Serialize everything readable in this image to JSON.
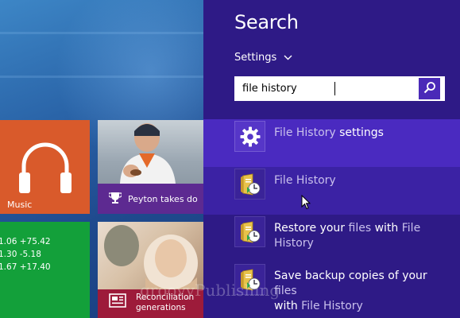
{
  "start_screen": {
    "tiles": {
      "music": {
        "label": "Music",
        "color": "#d95a2b",
        "icon": "headphones-icon"
      },
      "sports": {
        "caption": "Peyton takes do",
        "color": "#5d2a91",
        "icon": "trophy-icon"
      },
      "finance": {
        "rows": [
          "1.06  +75.42",
          "1.30  -5.18",
          "1.67  +17.40"
        ],
        "color": "#13a03a"
      },
      "news": {
        "caption_line1": "Reconciliation",
        "caption_line2": "generations",
        "color": "#9d1b3a",
        "icon": "newspaper-icon"
      }
    }
  },
  "search_charm": {
    "title": "Search",
    "scope": "Settings",
    "query": "file history",
    "search_button_icon": "magnifier-icon",
    "accent": "#4a2ac0",
    "results": [
      {
        "icon": "gear-icon",
        "highlight": "File History",
        "rest": " settings",
        "selected": true
      },
      {
        "icon": "file-history-folder-icon",
        "highlight": "File History",
        "rest": ""
      },
      {
        "icon": "file-history-folder-icon",
        "prefix": "Restore your ",
        "highlight": "files",
        "middle": " with ",
        "highlight2": "File History"
      },
      {
        "icon": "file-history-folder-icon",
        "prefix": "Save backup copies of your ",
        "highlight": "files",
        "line2_prefix": "with ",
        "highlight2": "File History"
      }
    ]
  },
  "watermark": "groovyPublishing"
}
